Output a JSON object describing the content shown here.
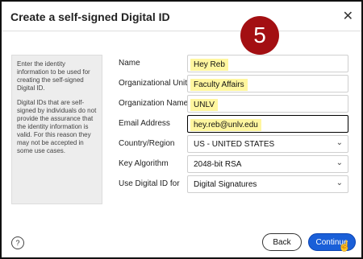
{
  "dialog": {
    "title": "Create a self-signed Digital ID",
    "close_icon": "close-icon",
    "step_badge": "5",
    "info_paragraph_1": "Enter the identity information to be used for creating the self-signed Digital ID.",
    "info_paragraph_2": "Digital IDs that are self-signed by individuals do not provide the assurance that the identity information is valid. For this reason they may not be accepted in some use cases."
  },
  "form": {
    "name_label": "Name",
    "name_value": "Hey Reb",
    "org_unit_label": "Organizational Unit",
    "org_unit_value": "Faculty Affairs",
    "org_name_label": "Organization Name",
    "org_name_value": "UNLV",
    "email_label": "Email Address",
    "email_value": "hey.reb@unlv.edu",
    "country_label": "Country/Region",
    "country_value": "US - UNITED STATES",
    "key_label": "Key Algorithm",
    "key_value": "2048-bit RSA",
    "use_label": "Use Digital ID for",
    "use_value": "Digital Signatures"
  },
  "footer": {
    "help_icon": "question-circle-icon",
    "help_glyph": "?",
    "back_label": "Back",
    "continue_label": "Continue"
  },
  "colors": {
    "highlight": "#fff69f",
    "badge": "#a30f12",
    "primary_button": "#1a5fd8"
  }
}
